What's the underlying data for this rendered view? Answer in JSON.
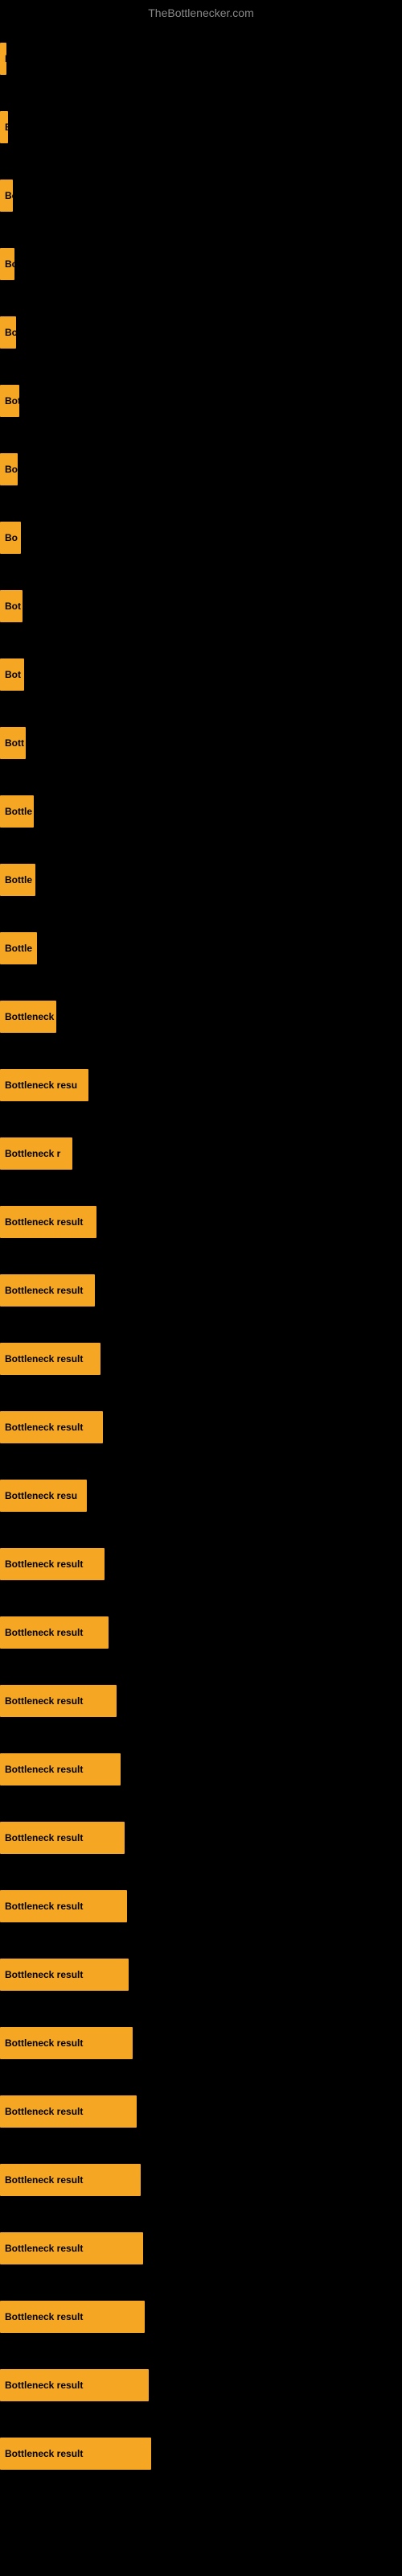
{
  "site_title": "TheBottlenecker.com",
  "bars": [
    {
      "label": "B",
      "width": 8
    },
    {
      "label": "B",
      "width": 10
    },
    {
      "label": "Bo",
      "width": 16
    },
    {
      "label": "Bo",
      "width": 18
    },
    {
      "label": "Bo",
      "width": 20
    },
    {
      "label": "Bot",
      "width": 24
    },
    {
      "label": "Bo",
      "width": 22
    },
    {
      "label": "Bo",
      "width": 26
    },
    {
      "label": "Bot",
      "width": 28
    },
    {
      "label": "Bot",
      "width": 30
    },
    {
      "label": "Bott",
      "width": 32
    },
    {
      "label": "Bottle",
      "width": 42
    },
    {
      "label": "Bottle",
      "width": 44
    },
    {
      "label": "Bottle",
      "width": 46
    },
    {
      "label": "Bottleneck",
      "width": 70
    },
    {
      "label": "Bottleneck resu",
      "width": 110
    },
    {
      "label": "Bottleneck r",
      "width": 90
    },
    {
      "label": "Bottleneck result",
      "width": 120
    },
    {
      "label": "Bottleneck result",
      "width": 118
    },
    {
      "label": "Bottleneck result",
      "width": 125
    },
    {
      "label": "Bottleneck result",
      "width": 128
    },
    {
      "label": "Bottleneck resu",
      "width": 108
    },
    {
      "label": "Bottleneck result",
      "width": 130
    },
    {
      "label": "Bottleneck result",
      "width": 135
    },
    {
      "label": "Bottleneck result",
      "width": 145
    },
    {
      "label": "Bottleneck result",
      "width": 150
    },
    {
      "label": "Bottleneck result",
      "width": 155
    },
    {
      "label": "Bottleneck result",
      "width": 158
    },
    {
      "label": "Bottleneck result",
      "width": 160
    },
    {
      "label": "Bottleneck result",
      "width": 165
    },
    {
      "label": "Bottleneck result",
      "width": 170
    },
    {
      "label": "Bottleneck result",
      "width": 175
    },
    {
      "label": "Bottleneck result",
      "width": 178
    },
    {
      "label": "Bottleneck result",
      "width": 180
    },
    {
      "label": "Bottleneck result",
      "width": 185
    },
    {
      "label": "Bottleneck result",
      "width": 188
    }
  ]
}
